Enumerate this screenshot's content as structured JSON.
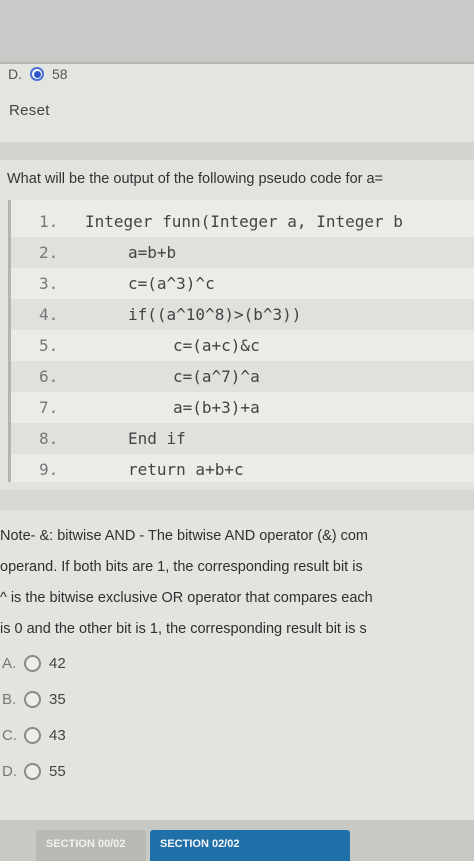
{
  "previous_question": {
    "option_letter": "D.",
    "selected_value": "58",
    "reset_label": "Reset"
  },
  "question": {
    "text": "What will be the output of the following pseudo code for a=",
    "code": [
      {
        "num": "1.",
        "text": "Integer funn(Integer a, Integer b",
        "indent": 0
      },
      {
        "num": "2.",
        "text": "a=b+b",
        "indent": 1
      },
      {
        "num": "3.",
        "text": "c=(a^3)^c",
        "indent": 1
      },
      {
        "num": "4.",
        "text": "if((a^10^8)>(b^3))",
        "indent": 1
      },
      {
        "num": "5.",
        "text": "c=(a+c)&c",
        "indent": 2
      },
      {
        "num": "6.",
        "text": "c=(a^7)^a",
        "indent": 2
      },
      {
        "num": "7.",
        "text": "a=(b+3)+a",
        "indent": 2
      },
      {
        "num": "8.",
        "text": "End if",
        "indent": 1
      },
      {
        "num": "9.",
        "text": "return a+b+c",
        "indent": 1
      }
    ],
    "note_lines": [
      "Note- &: bitwise AND - The bitwise AND operator (&) com",
      "operand. If both bits are 1, the corresponding result bit is",
      "^ is the bitwise exclusive OR operator that compares each",
      "is 0 and the other bit is 1, the corresponding result bit is s"
    ],
    "options": [
      {
        "letter": "A.",
        "value": "42"
      },
      {
        "letter": "B.",
        "value": "35"
      },
      {
        "letter": "C.",
        "value": "43"
      },
      {
        "letter": "D.",
        "value": "55"
      }
    ]
  },
  "footer": {
    "section_prev": "SECTION 00/02",
    "section_current": "SECTION 02/02"
  }
}
